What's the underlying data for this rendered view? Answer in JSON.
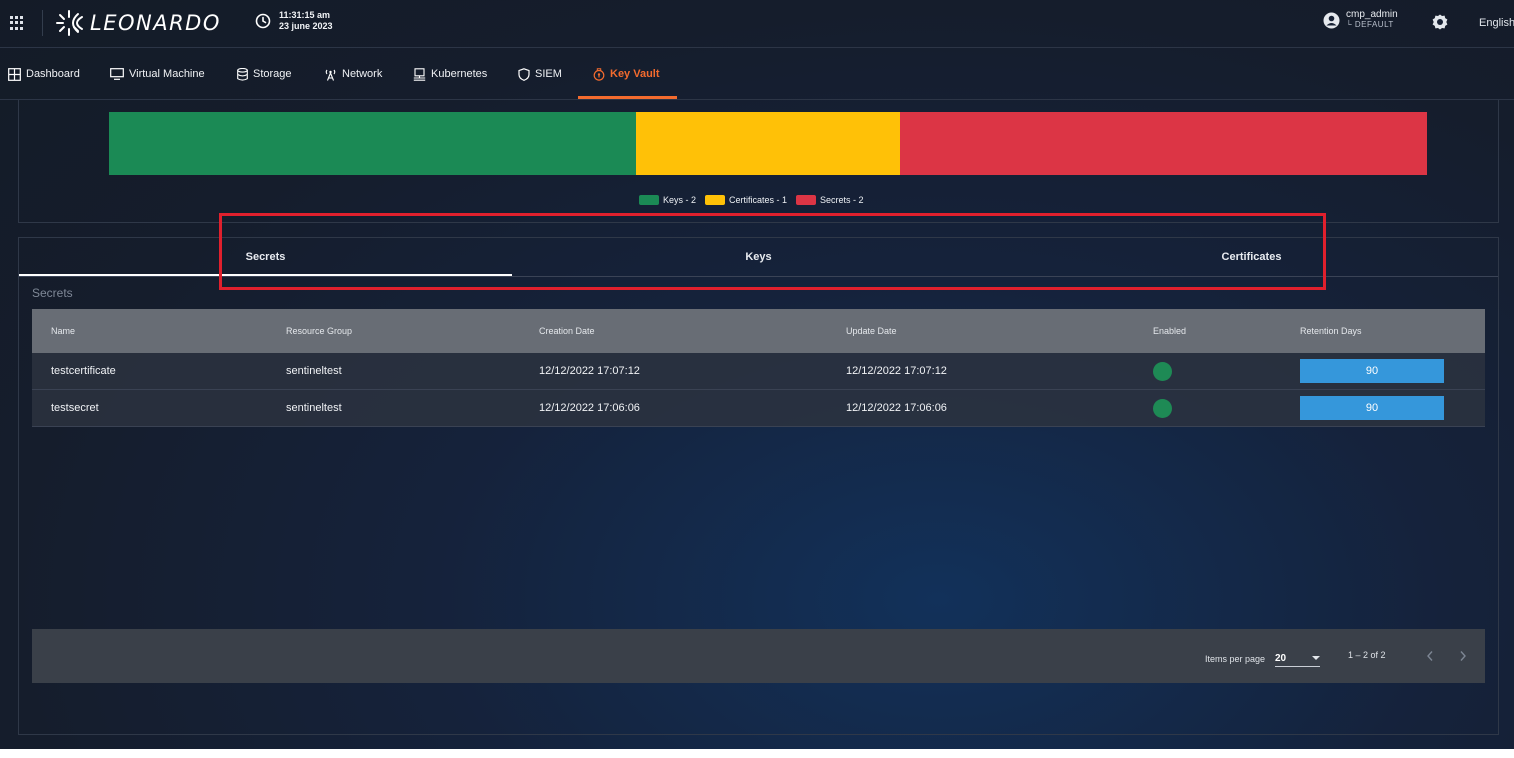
{
  "header": {
    "logo_text": "LEONARDO",
    "time": "11:31:15 am",
    "date": "23 june 2023",
    "user_name": "cmp_admin",
    "user_tenant": "└ DEFAULT",
    "language": "English"
  },
  "nav": {
    "items": [
      {
        "label": "Dashboard",
        "icon": "dashboard-icon"
      },
      {
        "label": "Virtual Machine",
        "icon": "monitor-icon"
      },
      {
        "label": "Storage",
        "icon": "database-icon"
      },
      {
        "label": "Network",
        "icon": "antenna-icon"
      },
      {
        "label": "Kubernetes",
        "icon": "kubernetes-icon"
      },
      {
        "label": "SIEM",
        "icon": "shield-icon"
      },
      {
        "label": "Key Vault",
        "icon": "key-vault-icon",
        "active": true
      }
    ]
  },
  "summary": {
    "legend": [
      {
        "label": "Keys - 2",
        "color": "#1b8a55"
      },
      {
        "label": "Certificates - 1",
        "color": "#ffc107"
      },
      {
        "label": "Secrets - 2",
        "color": "#dc3545"
      }
    ],
    "values": {
      "keys": 2,
      "certificates": 1,
      "secrets": 2
    }
  },
  "tabs": {
    "items": [
      "Secrets",
      "Keys",
      "Certificates"
    ],
    "active": "Secrets"
  },
  "table": {
    "title": "Secrets",
    "columns": [
      "Name",
      "Resource Group",
      "Creation Date",
      "Update Date",
      "Enabled",
      "Retention Days"
    ],
    "rows": [
      {
        "name": "testcertificate",
        "resource_group": "sentineltest",
        "creation_date": "12/12/2022 17:07:12",
        "update_date": "12/12/2022 17:07:12",
        "enabled": true,
        "retention_days": "90"
      },
      {
        "name": "testsecret",
        "resource_group": "sentineltest",
        "creation_date": "12/12/2022 17:06:06",
        "update_date": "12/12/2022 17:06:06",
        "enabled": true,
        "retention_days": "90"
      }
    ]
  },
  "paginator": {
    "items_per_page_label": "Items per page",
    "items_per_page": "20",
    "range": "1 – 2 of 2"
  },
  "colors": {
    "accent": "#f36b2e",
    "enabled": "#1e8a55",
    "retention": "#3597db",
    "highlight": "#e0202d"
  }
}
